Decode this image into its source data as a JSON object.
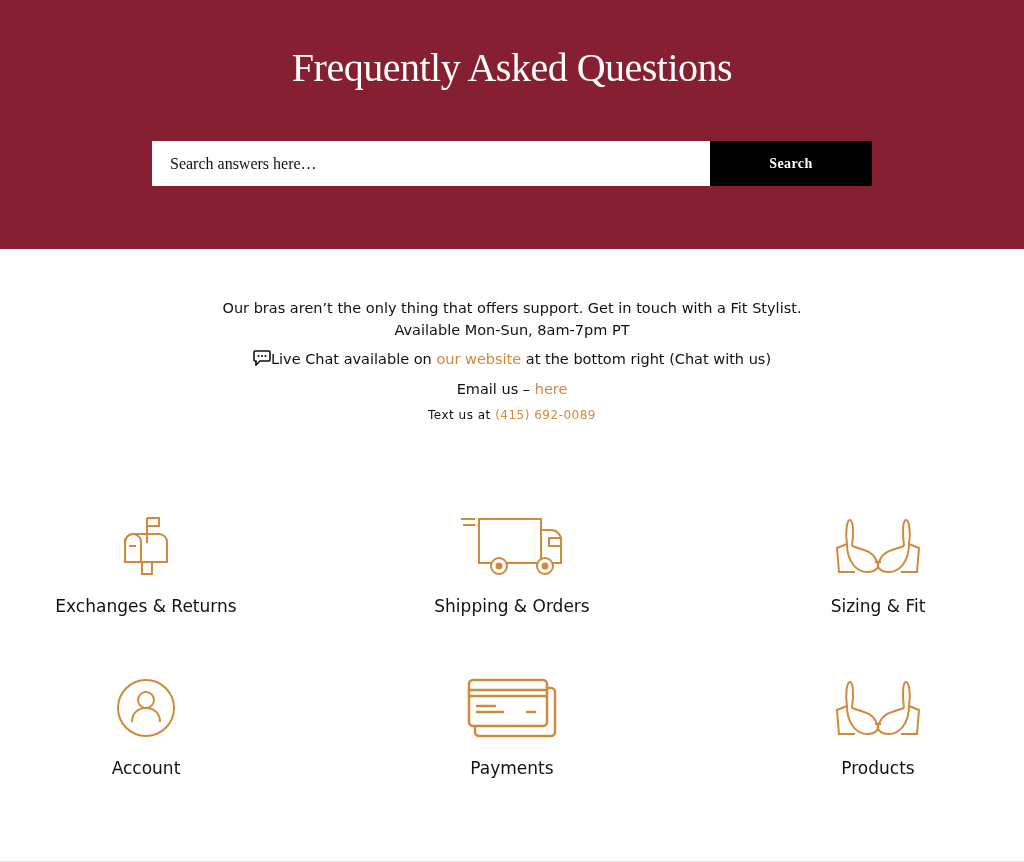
{
  "header": {
    "title": "Frequently Asked Questions",
    "search": {
      "placeholder": "Search answers here…",
      "button": "Search"
    }
  },
  "contact": [
    {
      "kind": "text",
      "text": "Our bras aren’t the only thing that offers support. Get in touch with a Fit Stylist."
    },
    {
      "kind": "text",
      "text": "Available Mon-Sun, 8am-7pm PT"
    },
    {
      "kind": "chat",
      "before": "Live Chat available on",
      "link": "our website",
      "after": "at the bottom right (Chat with us)"
    },
    {
      "kind": "link",
      "before": "Email us –",
      "link": "here"
    },
    {
      "kind": "small",
      "before": "Text us at",
      "link": "(415) 692-0089"
    }
  ],
  "categories": [
    {
      "kind": "mailbox",
      "label": "Exchanges & Returns"
    },
    {
      "kind": "truck",
      "label": "Shipping & Orders"
    },
    {
      "kind": "bra",
      "label": "Sizing & Fit"
    },
    {
      "kind": "person",
      "label": "Account"
    },
    {
      "kind": "card",
      "label": "Payments"
    },
    {
      "kind": "bra",
      "label": "Products"
    }
  ]
}
